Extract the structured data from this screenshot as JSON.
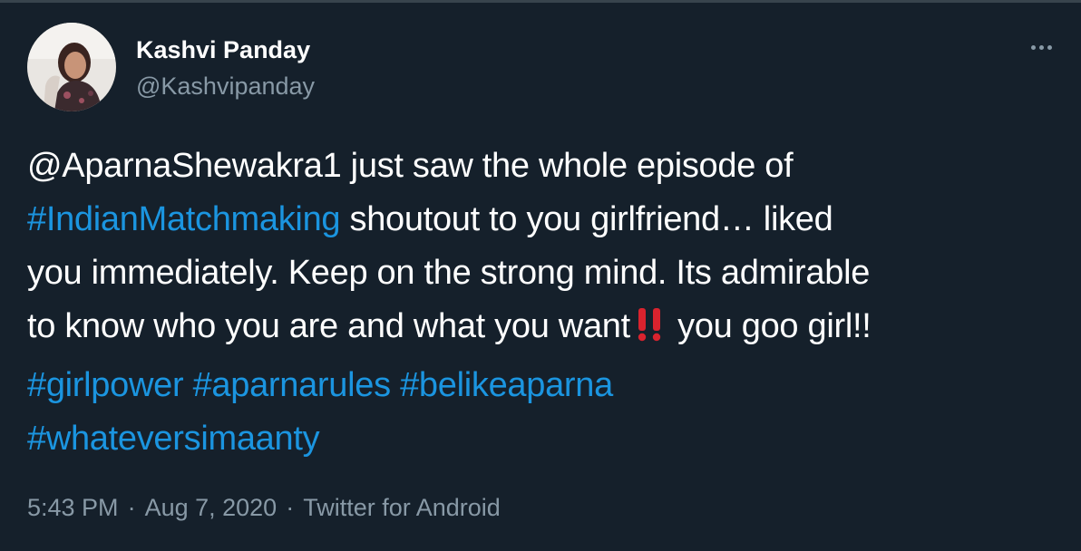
{
  "author": {
    "display_name": "Kashvi Panday",
    "handle": "@Kashvipanday"
  },
  "tweet": {
    "lines": [
      [
        {
          "text": "@AparnaShewakra1",
          "type": "text"
        },
        {
          "text": " just saw the whole episode of",
          "type": "text"
        }
      ],
      [
        {
          "text": "#IndianMatchmaking",
          "type": "hashtag"
        },
        {
          "text": " shoutout to you girlfriend… liked",
          "type": "text"
        }
      ],
      [
        {
          "text": "you immediately. Keep on the strong mind. Its admirable",
          "type": "text"
        }
      ],
      [
        {
          "text": "to know who you are and what you want",
          "type": "text"
        },
        {
          "text": "double-exclamation-emoji",
          "type": "emoji"
        },
        {
          "text": " you goo girl!!",
          "type": "text"
        }
      ],
      [
        {
          "text": "#girlpower",
          "type": "hashtag"
        },
        {
          "text": " ",
          "type": "text"
        },
        {
          "text": "#aparnarules",
          "type": "hashtag"
        },
        {
          "text": " ",
          "type": "text"
        },
        {
          "text": "#belikeaparna",
          "type": "hashtag"
        }
      ],
      [
        {
          "text": "#whateversimaanty",
          "type": "hashtag"
        }
      ]
    ]
  },
  "meta": {
    "time": "5:43 PM",
    "date": "Aug 7, 2020",
    "source": "Twitter for Android",
    "separator": "·"
  },
  "icons": {
    "more": "more-horizontal-icon"
  },
  "colors": {
    "background": "#15202b",
    "link": "#1b95e0",
    "secondary_text": "#8899a6",
    "emoji_red": "#d9232e"
  }
}
